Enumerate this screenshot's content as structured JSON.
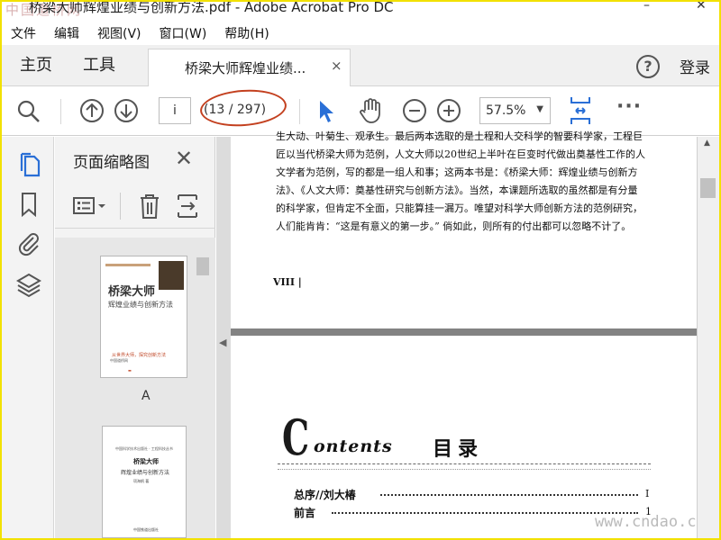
{
  "window": {
    "title": "桥梁大师辉煌业绩与创新方法.pdf - Adobe Acrobat Pro DC",
    "minimize": "–",
    "close": "✕",
    "watermark_top": "中国道桥网"
  },
  "menu": {
    "items": [
      "文件",
      "编辑",
      "视图(V)",
      "窗口(W)",
      "帮助(H)"
    ]
  },
  "tabs": {
    "home": "主页",
    "tools": "工具",
    "document": "桥梁大师辉煌业绩...",
    "document_close": "×",
    "help": "?",
    "login": "登录"
  },
  "toolbar": {
    "page_current": "i",
    "page_count": "(13 / 297)",
    "zoom": "57.5%",
    "more": "···"
  },
  "thumbnails": {
    "title": "页面缩略图",
    "close": "✕",
    "page_a_label": "A",
    "cover_title": "桥梁大师",
    "cover_subtitle": "辉煌业绩与创新方法",
    "cover_red_line": "从世界大师，探究创新方法",
    "cover_small_line": "中国道桥网",
    "title_page_line1": "中国科学技术出版社 · 工程科技丛书",
    "title_page_line2": "桥梁大师",
    "title_page_line3": "辉煌业绩与创新方法",
    "title_page_line4": "项海帆 著",
    "title_page_line5": "中国铁道出版社"
  },
  "document": {
    "page1_paragraph": "生大动、叶菊生、观承生。最后两本选取的是土程和人交科学的智要科学家，工程巨匠以当代桥梁大师为范例，人文大师以20世纪上半叶在巨变时代做出奠基性工作的人文学者为范例，写的都是一组人和事；这两本书是：《桥梁大师：辉煌业绩与创新方法》、《人文大师：奠基性研究与创新方法》。当然，本课题所选取的虽然都是有分量的科学家，但肯定不全面，只能算挂一漏万。唯望对科学大师创新方法的范例研究，人们能肯肯：“这是有意义的第一步。” 倘如此，则所有的付出都可以忽略不计了。",
    "page1_roman": "VIII |",
    "contents_big_c": "C",
    "contents_word": "ontents",
    "contents_cn": "目录",
    "toc": [
      {
        "label": "总序//刘大椿",
        "page": "I"
      },
      {
        "label": "前言",
        "page": "1"
      }
    ],
    "watermark_bottom": "www.cndao.com"
  }
}
